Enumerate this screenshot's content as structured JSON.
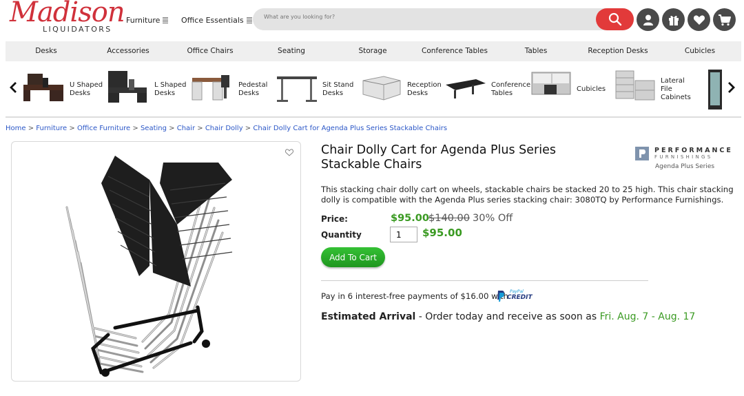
{
  "header": {
    "logo_script": "Madison",
    "logo_sub": "LIQUIDATORS",
    "menu": [
      "Furniture",
      "Office Essentials"
    ],
    "search_placeholder": "What are you looking for?",
    "icons": [
      "search-icon",
      "user-icon",
      "gift-icon",
      "heart-icon",
      "cart-icon"
    ]
  },
  "category_nav": [
    "Desks",
    "Accessories",
    "Office Chairs",
    "Seating",
    "Storage",
    "Conference Tables",
    "Tables",
    "Reception Desks",
    "Cubicles"
  ],
  "carousel": [
    {
      "label": "U Shaped Desks"
    },
    {
      "label": "L Shaped Desks"
    },
    {
      "label": "Pedestal Desks"
    },
    {
      "label": "Sit Stand Desks"
    },
    {
      "label": "Reception Desks"
    },
    {
      "label": "Conference Tables"
    },
    {
      "label": "Cubicles"
    },
    {
      "label": "Lateral File Cabinets"
    }
  ],
  "breadcrumb": [
    "Home",
    "Furniture",
    "Office Furniture",
    "Seating",
    "Chair",
    "Chair Dolly",
    "Chair Dolly Cart for Agenda Plus Series Stackable Chairs"
  ],
  "product": {
    "title": "Chair Dolly Cart for Agenda Plus Series Stackable Chairs",
    "brand_line1": "PERFORMANCE",
    "brand_line2": "FURNISHINGS",
    "series": "Agenda Plus Series",
    "description": "This stacking chair dolly cart on wheels, stackable chairs be stacked 20 to 25 high. This chair stacking dolly is compatible with the Agenda Plus series stacking chair: 3080TQ by Performance Furnishings.",
    "price_label": "Price:",
    "price": "$95.00",
    "old_price": "$140.00",
    "discount": "30% Off",
    "quantity_label": "Quantity",
    "quantity": "1",
    "line_total": "$95.00",
    "add_to_cart": "Add To Cart",
    "paypal_text": "Pay in 6 interest-free payments of $16.00 with",
    "paypal_brand_top": "PayPal",
    "paypal_brand_bottom": "CREDIT",
    "arrival_label": "Estimated Arrival",
    "arrival_text": " - Order today and receive as soon as ",
    "arrival_dates": "Fri. Aug. 7 - Aug. 17"
  },
  "colors": {
    "brand_red": "#d0313b",
    "search_red": "#e23a3a",
    "price_green": "#3a9a22",
    "link_blue": "#2b57c7",
    "cart_green": "#2aab2a"
  }
}
